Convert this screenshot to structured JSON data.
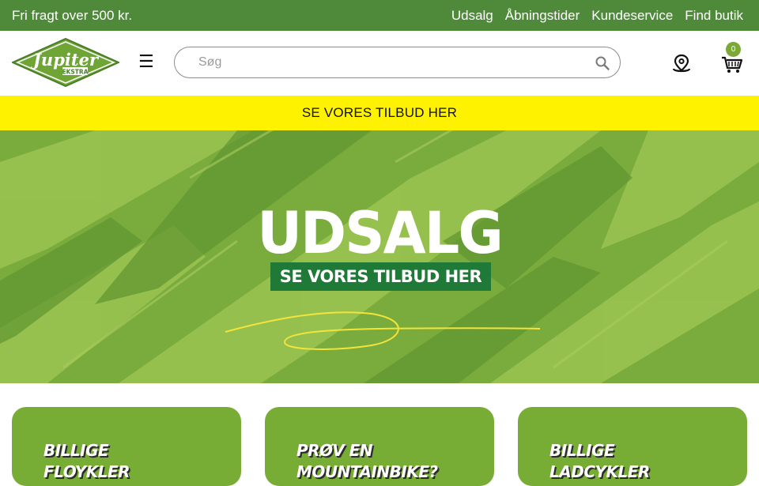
{
  "topbar": {
    "shipping_text": "Fri fragt over 500 kr.",
    "links": [
      "Udsalg",
      "Åbningstider",
      "Kundeservice",
      "Find butik"
    ]
  },
  "header": {
    "logo_text": "Jupiter",
    "logo_subtext": "EKSTRA",
    "menu_icon": "hamburger-icon",
    "search_placeholder": "Søg",
    "cart_count": "0"
  },
  "promo_bar": {
    "text": "SE VORES TILBUD HER",
    "background": "#fff200"
  },
  "hero": {
    "title": "UDSALG",
    "subtitle": "SE VORES TILBUD HER"
  },
  "cards": [
    {
      "title_line1": "BILLIGE",
      "title_line2": "FLOYKLER"
    },
    {
      "title_line1": "PRØV EN",
      "title_line2": "MOUNTAINBIKE?"
    },
    {
      "title_line1": "BILLIGE",
      "title_line2": "LADCYKLER"
    }
  ],
  "colors": {
    "topbar": "#4f8a3a",
    "accent_green": "#77ad34",
    "dark_green": "#1f7a38",
    "yellow": "#fff200"
  }
}
